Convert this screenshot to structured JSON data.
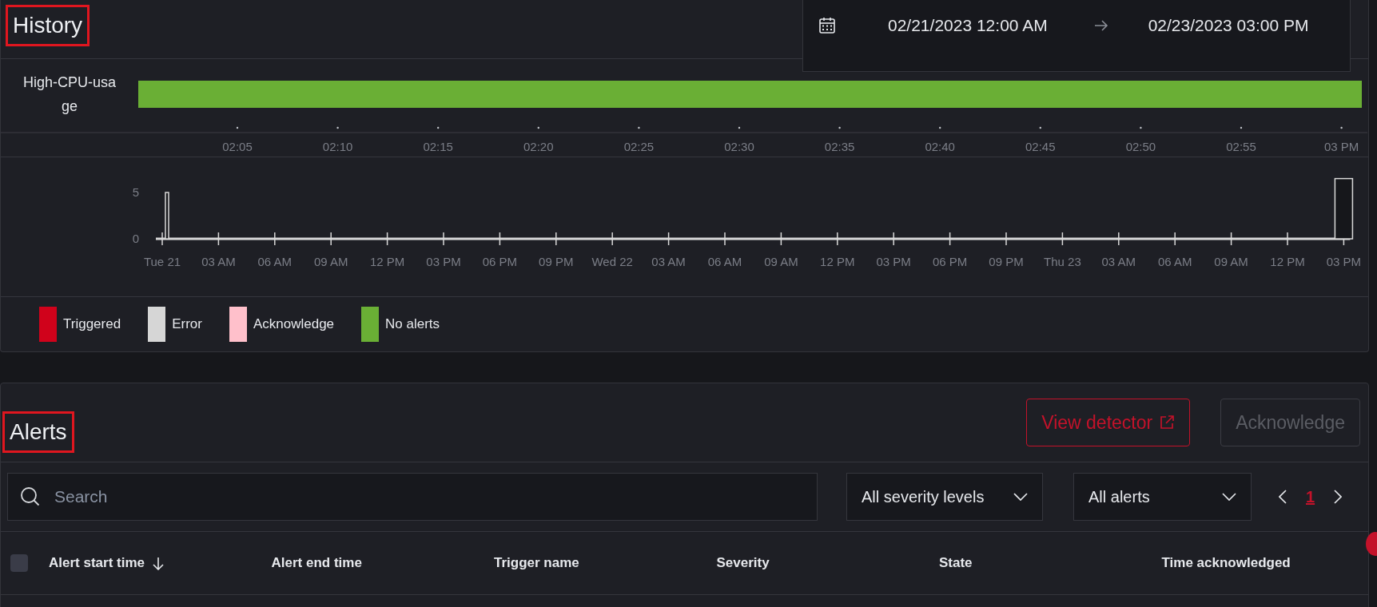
{
  "history": {
    "title": "History",
    "highlighted": true,
    "date_range": {
      "start": "02/21/2023 12:00 AM",
      "end": "02/23/2023 03:00 PM"
    },
    "timeline": {
      "label": "High-CPU-usage",
      "color": "#6aaf35",
      "ticks": [
        "02:05",
        "02:10",
        "02:15",
        "02:20",
        "02:25",
        "02:30",
        "02:35",
        "02:40",
        "02:45",
        "02:50",
        "02:55",
        "03 PM"
      ]
    },
    "chart_data": {
      "type": "bar",
      "categories": [
        "Tue 21",
        "03 AM",
        "06 AM",
        "09 AM",
        "12 PM",
        "03 PM",
        "06 PM",
        "09 PM",
        "Wed 22",
        "03 AM",
        "06 AM",
        "09 AM",
        "12 PM",
        "03 PM",
        "06 PM",
        "09 PM",
        "Thu 23",
        "03 AM",
        "06 AM",
        "09 AM",
        "12 PM",
        "03 PM"
      ],
      "yticks": [
        0,
        5
      ],
      "ylim": [
        0,
        6.5
      ],
      "series": [
        {
          "color": "#d9d9d9",
          "values": [
            5,
            0,
            0,
            0,
            0,
            0,
            0,
            0,
            0,
            0,
            0,
            0,
            0,
            0,
            0,
            0,
            0,
            0,
            0,
            0,
            0,
            6.5
          ]
        }
      ]
    },
    "legend": [
      {
        "label": "Triggered",
        "color": "#d0021b"
      },
      {
        "label": "Error",
        "color": "#d6d6d6"
      },
      {
        "label": "Acknowledge",
        "color": "#ffc0cb"
      },
      {
        "label": "No alerts",
        "color": "#6aaf35"
      }
    ]
  },
  "alerts": {
    "title": "Alerts",
    "highlighted": true,
    "buttons": [
      {
        "label": "View detector",
        "kind": "external",
        "disabled": false
      },
      {
        "label": "Acknowledge",
        "kind": "plain",
        "disabled": true
      }
    ],
    "search": {
      "placeholder": "Search"
    },
    "filters": [
      {
        "value": "All severity levels"
      },
      {
        "value": "All alerts"
      }
    ],
    "pagination": [
      {
        "label": "1",
        "selected": true
      }
    ],
    "table": {
      "select_all": {
        "checked": false
      },
      "columns": [
        {
          "label": "Alert start time",
          "sorted": true
        },
        {
          "label": "Alert end time",
          "sorted": false
        },
        {
          "label": "Trigger name",
          "sorted": false
        },
        {
          "label": "Severity",
          "sorted": false
        },
        {
          "label": "State",
          "sorted": false
        },
        {
          "label": "Time acknowledged",
          "sorted": false
        }
      ]
    }
  }
}
